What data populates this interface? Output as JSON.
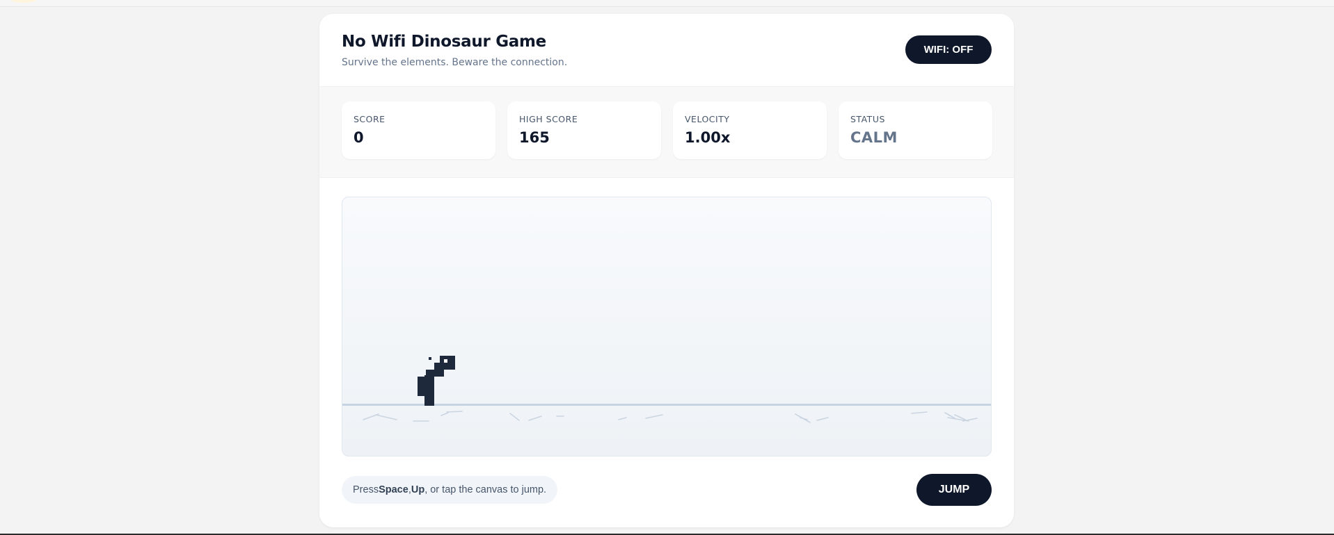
{
  "header": {
    "title": "No Wifi Dinosaur Game",
    "subtitle": "Survive the elements. Beware the connection.",
    "wifi_button": "WIFI: OFF"
  },
  "stats": [
    {
      "label": "SCORE",
      "value": "0"
    },
    {
      "label": "HIGH SCORE",
      "value": "165"
    },
    {
      "label": "VELOCITY",
      "value": "1.00x"
    },
    {
      "label": "STATUS",
      "value": "CALM"
    }
  ],
  "game": {
    "canvas": "game-canvas",
    "player": "dinosaur",
    "ground": "ground-line"
  },
  "controls": {
    "hint_prefix": "Press ",
    "hint_key1": "Space",
    "hint_sep": ", ",
    "hint_key2": "Up",
    "hint_suffix": ", or tap the canvas to jump.",
    "jump_button": "JUMP"
  },
  "colors": {
    "primary": "#0f172a",
    "muted": "#64748b",
    "ground": "#c5d3e2",
    "pebbles": "#cbd5e1"
  }
}
